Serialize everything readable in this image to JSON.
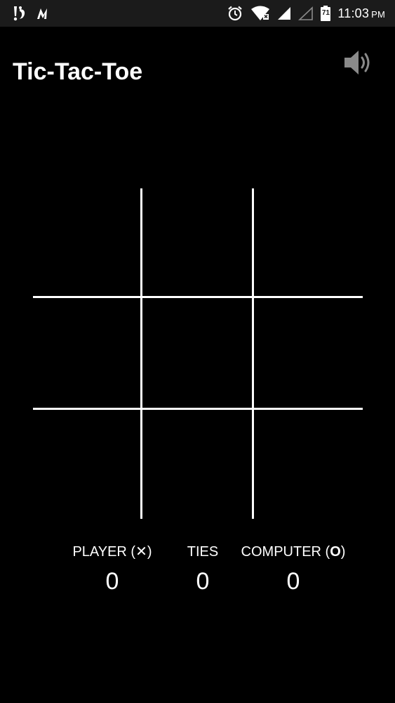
{
  "status_bar": {
    "time": "11:03",
    "ampm": "PM",
    "battery_level": "71",
    "icons": [
      "notification-icon",
      "m-logo-icon",
      "alarm-icon",
      "wifi-icon",
      "signal-icon",
      "signal-empty-icon",
      "battery-icon"
    ]
  },
  "app": {
    "title": "Tic-Tac-Toe",
    "sound_icon": "volume-icon"
  },
  "board": {
    "cells": [
      "",
      "",
      "",
      "",
      "",
      "",
      "",
      "",
      ""
    ]
  },
  "score": {
    "player_label": "PLAYER (",
    "player_symbol": "✕",
    "player_close": ")",
    "player_value": "0",
    "ties_label": "TIES",
    "ties_value": "0",
    "computer_label": "COMPUTER (",
    "computer_symbol": "O",
    "computer_close": ")",
    "computer_value": "0"
  },
  "colors": {
    "background": "#000000",
    "status_bar": "#1b1b1b",
    "foreground": "#ffffff",
    "icon_muted": "#8a8a8a"
  }
}
